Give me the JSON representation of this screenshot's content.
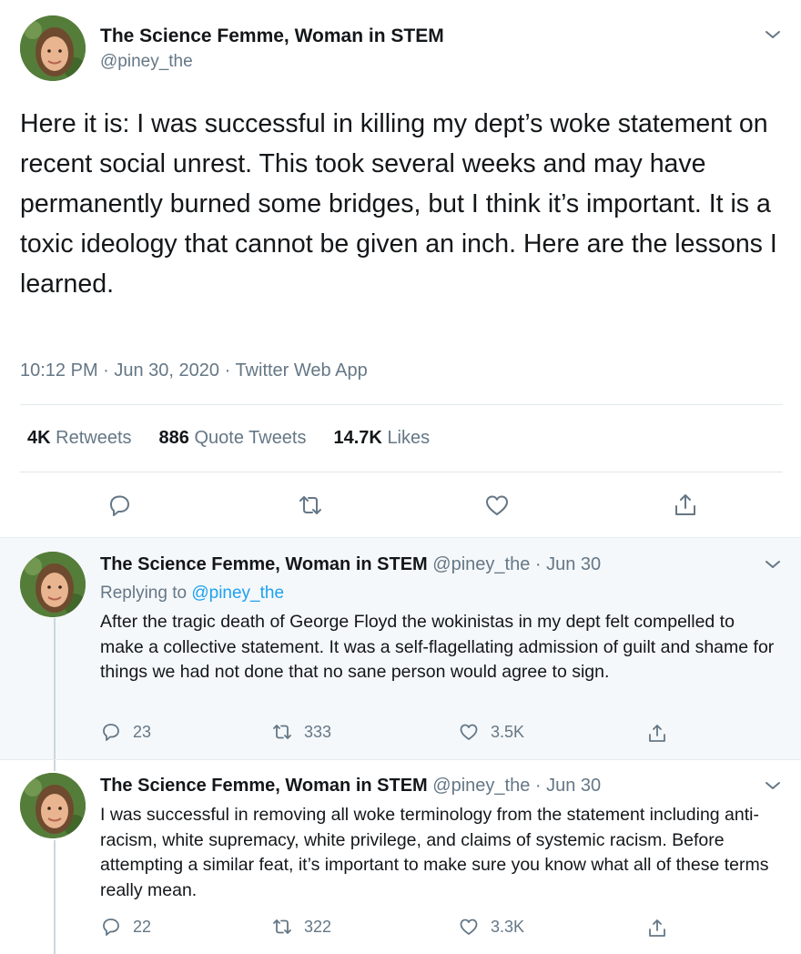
{
  "main_tweet": {
    "author_name": "The Science Femme, Woman in STEM",
    "author_handle": "@piney_the",
    "text": "Here it is: I was successful in killing my dept’s woke statement on recent social unrest. This took several weeks and may have permanently burned some bridges, but I think it’s important. It is a toxic ideology that cannot be given an inch. Here are the lessons I learned.",
    "meta": "10:12 PM · Jun 30, 2020 · Twitter Web App",
    "stats": {
      "retweets_count": "4K",
      "retweets_label": "Retweets",
      "quotes_count": "886",
      "quotes_label": "Quote Tweets",
      "likes_count": "14.7K",
      "likes_label": "Likes"
    }
  },
  "replies": [
    {
      "author_name": "The Science Femme, Woman in STEM",
      "subline": "@piney_the · Jun 30",
      "replying_prefix": "Replying to",
      "replying_to": "@piney_the",
      "text": "After the tragic death of George Floyd the wokinistas in my dept felt compelled to make a collective statement. It was a self-flagellating admission of guilt and shame for things we had not done that no sane person would agree to sign.",
      "reply_count": "23",
      "retweet_count": "333",
      "like_count": "3.5K"
    },
    {
      "author_name": "The Science Femme, Woman in STEM",
      "subline": "@piney_the · Jun 30",
      "text": "I was successful in removing all woke terminology from the statement including anti-racism, white supremacy, white privilege, and claims of systemic racism. Before attempting a similar feat, it’s important to make sure you know what all of these terms really mean.",
      "reply_count": "22",
      "retweet_count": "322",
      "like_count": "3.3K"
    }
  ],
  "colors": {
    "text": "#14171a",
    "secondary": "#657786",
    "link": "#1da1f2",
    "thread_bg": "#f5f8fa"
  },
  "icons": [
    "avatar",
    "chevron-down-icon",
    "reply-icon",
    "retweet-icon",
    "like-icon",
    "share-icon"
  ]
}
